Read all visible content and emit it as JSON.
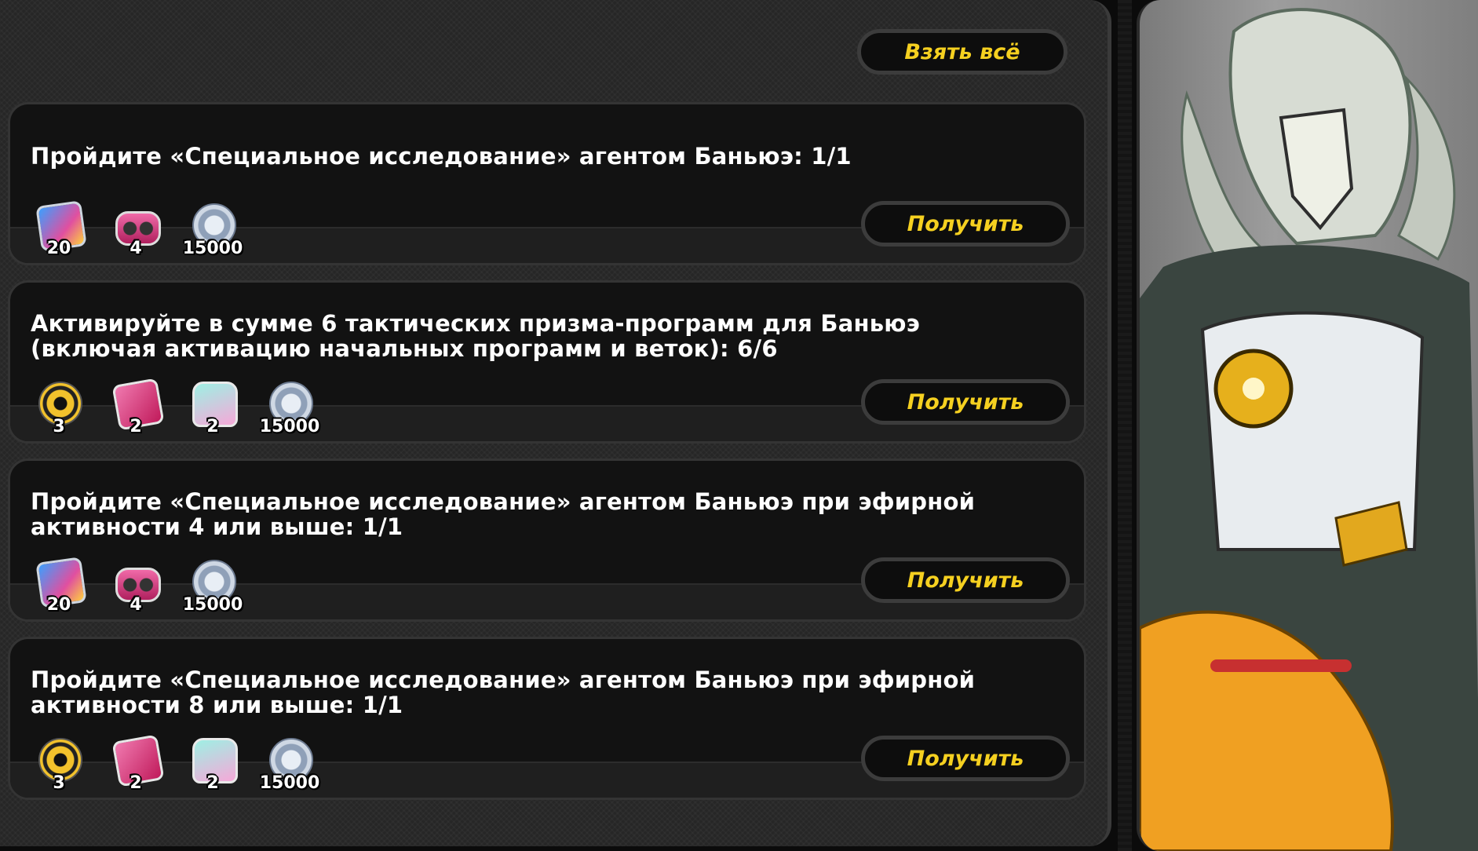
{
  "header": {
    "claim_all_label": "Взять всё"
  },
  "tasks": [
    {
      "title_lines": [
        "Пройдите «Специальное исследование» агентом Баньюэ: 1/1"
      ],
      "rewards": [
        {
          "icon": "film-reel-icon",
          "qty": "20"
        },
        {
          "icon": "tape-icon",
          "qty": "4"
        },
        {
          "icon": "denny-coin-icon",
          "qty": "15000"
        }
      ],
      "button_label": "Получить"
    },
    {
      "title_lines": [
        "Активируйте в сумме 6 тактических призма-программ для Баньюэ",
        "(включая активацию начальных программ и веток): 6/6"
      ],
      "rewards": [
        {
          "icon": "core-icon",
          "qty": "3"
        },
        {
          "icon": "chip-icon",
          "qty": "2"
        },
        {
          "icon": "bag-icon",
          "qty": "2"
        },
        {
          "icon": "denny-coin-icon",
          "qty": "15000"
        }
      ],
      "button_label": "Получить"
    },
    {
      "title_lines": [
        "Пройдите «Специальное исследование» агентом Баньюэ при эфирной",
        "активности 4 или выше: 1/1"
      ],
      "rewards": [
        {
          "icon": "film-reel-icon",
          "qty": "20"
        },
        {
          "icon": "tape-icon",
          "qty": "4"
        },
        {
          "icon": "denny-coin-icon",
          "qty": "15000"
        }
      ],
      "button_label": "Получить"
    },
    {
      "title_lines": [
        "Пройдите «Специальное исследование» агентом Баньюэ при эфирной",
        "активности 8 или выше: 1/1"
      ],
      "rewards": [
        {
          "icon": "core-icon",
          "qty": "3"
        },
        {
          "icon": "chip-icon",
          "qty": "2"
        },
        {
          "icon": "bag-icon",
          "qty": "2"
        },
        {
          "icon": "denny-coin-icon",
          "qty": "15000"
        }
      ],
      "button_label": "Получить"
    }
  ],
  "colors": {
    "accent": "#f5d020",
    "card": "#121212",
    "panel": "#262626"
  }
}
